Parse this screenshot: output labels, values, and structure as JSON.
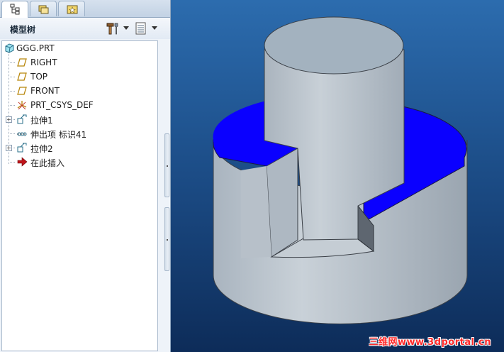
{
  "tabs": [
    {
      "icon": "model-tree-icon"
    },
    {
      "icon": "folder-browser-icon"
    },
    {
      "icon": "favorites-icon"
    }
  ],
  "tree_header": {
    "title": "模型树",
    "settings_icon": "tree-settings-icon",
    "columns_icon": "tree-columns-icon"
  },
  "tree": {
    "items": [
      {
        "label": "GGG.PRT",
        "icon": "part-icon"
      },
      {
        "label": "RIGHT",
        "icon": "datum-plane-icon"
      },
      {
        "label": "TOP",
        "icon": "datum-plane-icon"
      },
      {
        "label": "FRONT",
        "icon": "datum-plane-icon"
      },
      {
        "label": "PRT_CSYS_DEF",
        "icon": "coordinate-system-icon"
      },
      {
        "label": "拉伸1",
        "icon": "extrude-icon",
        "expandable": true
      },
      {
        "label": "伸出项 标识41",
        "icon": "protrusion-icon"
      },
      {
        "label": "拉伸2",
        "icon": "extrude-icon",
        "expandable": true
      },
      {
        "label": "在此插入",
        "icon": "insert-here-arrow-icon"
      }
    ]
  },
  "viewport": {
    "model": "stepped-cylinder-with-slot",
    "colors": {
      "background_top": "#2c6cae",
      "background_bottom": "#0d2c59",
      "model_face": "#b4bfc9",
      "highlight_face": "#0a00ff"
    },
    "watermark": "三维网www.3dportal.cn"
  }
}
